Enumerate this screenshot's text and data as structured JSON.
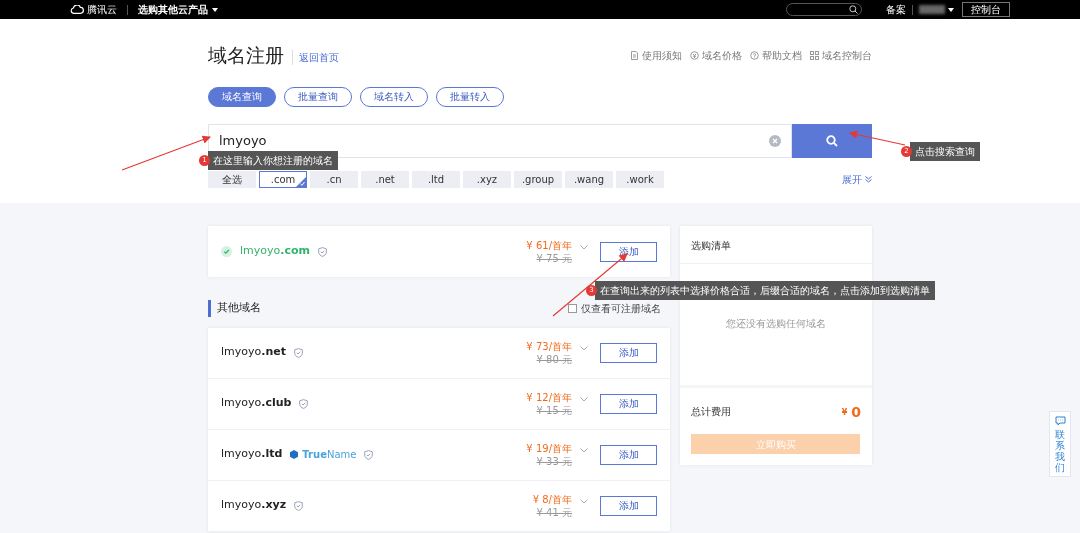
{
  "topbar": {
    "logo": "腾讯云",
    "product_menu": "选购其他云产品",
    "links": [
      "备案",
      "控制台"
    ]
  },
  "header": {
    "title": "域名注册",
    "home_link": "返回首页",
    "links": [
      {
        "label": "使用须知"
      },
      {
        "label": "域名价格"
      },
      {
        "label": "帮助文档"
      },
      {
        "label": "域名控制台"
      }
    ]
  },
  "tabs": [
    {
      "label": "域名查询",
      "selected": true
    },
    {
      "label": "批量查询",
      "selected": false
    },
    {
      "label": "域名转入",
      "selected": false
    },
    {
      "label": "批量转入",
      "selected": false
    }
  ],
  "search": {
    "value": "lmyoyo"
  },
  "suffixes": [
    {
      "label": "全选",
      "selected": false
    },
    {
      "label": ".com",
      "selected": true
    },
    {
      "label": ".cn",
      "selected": false
    },
    {
      "label": ".net",
      "selected": false
    },
    {
      "label": ".ltd",
      "selected": false
    },
    {
      "label": ".xyz",
      "selected": false
    },
    {
      "label": ".group",
      "selected": false
    },
    {
      "label": ".wang",
      "selected": false
    },
    {
      "label": ".work",
      "selected": false
    }
  ],
  "expand": "展开",
  "main_result": {
    "name": "lmyoyo",
    "suffix": ".com",
    "available": true,
    "price": "¥ 61/首年",
    "original_price": "¥ 75 元",
    "button": "添加"
  },
  "other_domains": {
    "title": "其他域名",
    "filter": {
      "label": "仅查看可注册域名",
      "checked": false
    },
    "items": [
      {
        "name": "lmyoyo",
        "suffix": ".net",
        "price": "¥ 73/首年",
        "original_price": "¥ 80 元",
        "button": "添加"
      },
      {
        "name": "lmyoyo",
        "suffix": ".club",
        "price": "¥ 12/首年",
        "original_price": "¥ 15 元",
        "button": "添加"
      },
      {
        "name": "lmyoyo",
        "suffix": ".ltd",
        "badge": "**True**Name",
        "price": "¥ 19/首年",
        "original_price": "¥ 33 元",
        "button": "添加"
      },
      {
        "name": "lmyoyo",
        "suffix": ".xyz",
        "price": "¥ 8/首年",
        "original_price": "¥ 41 元",
        "button": "添加"
      }
    ]
  },
  "cart": {
    "title": "选购清单",
    "empty": "您还没有选购任何域名",
    "total_label": "总计费用",
    "currency": "¥",
    "total": "0",
    "buy": "立即购买",
    "disabled": true
  },
  "contact": "联系我们",
  "annotations": [
    {
      "number": "1",
      "text": "在这里输入你想注册的域名"
    },
    {
      "number": "2",
      "text": "点击搜索查询"
    },
    {
      "number": "3",
      "text": "在查询出来的列表中选择价格合适，后缀合适的域名，点击添加到选购清单"
    }
  ]
}
